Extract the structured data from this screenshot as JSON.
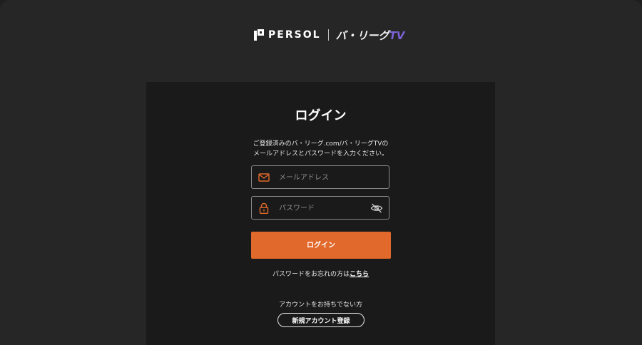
{
  "header": {
    "brand_primary": "PERSOL",
    "brand_secondary_main": "バ・リーグ",
    "brand_secondary_tv": "TV"
  },
  "login": {
    "title": "ログイン",
    "description_line1": "ご登録済みのバ・リーグ.com/バ・リーグTVの",
    "description_line2": "メールアドレスとパスワードを入力ください。",
    "email_placeholder": "メールアドレス",
    "email_value": "",
    "password_placeholder": "パスワード",
    "password_value": "",
    "submit_label": "ログイン",
    "forgot_text": "パスワードをお忘れの方は",
    "forgot_link": "こちら",
    "no_account_text": "アカウントをお持ちでない方",
    "signup_label": "新規アカウント登録"
  },
  "icons": {
    "brand_mark": "persol-mark-icon",
    "email": "mail-icon",
    "password": "lock-icon",
    "toggle_visibility": "eye-off-icon"
  },
  "colors": {
    "accent": "#e1692b",
    "card_bg": "#1a1a1a",
    "page_bg": "#262626",
    "tv_purple": "#7b63d6"
  }
}
